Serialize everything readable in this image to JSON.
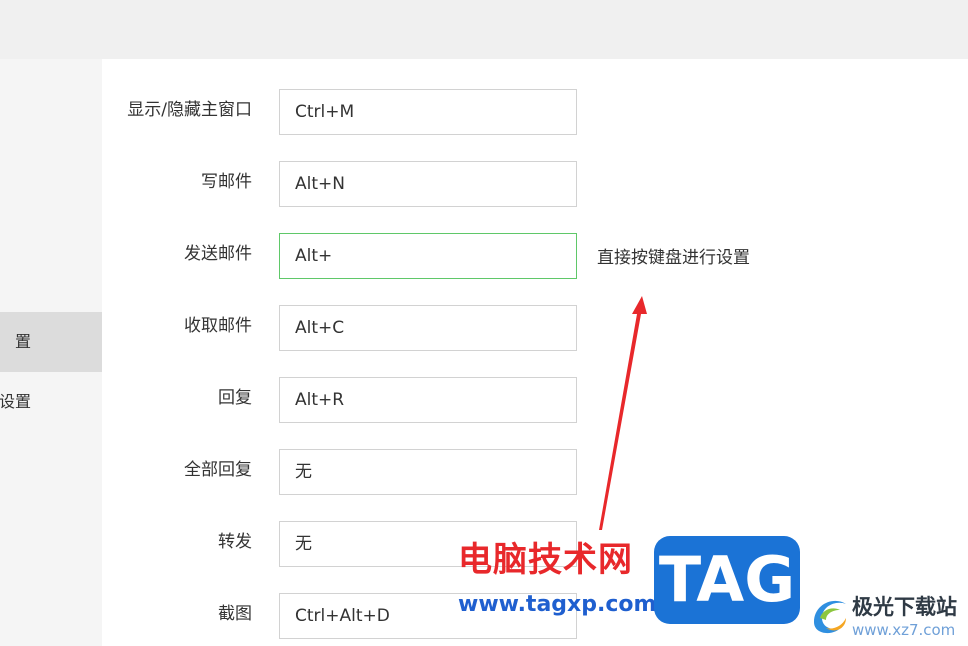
{
  "sidebar": {
    "items": [
      {
        "label": "置",
        "active": true
      },
      {
        "label": "设置",
        "active": false
      }
    ]
  },
  "shortcuts": [
    {
      "label": "显示/隐藏主窗口",
      "value": "Ctrl+M"
    },
    {
      "label": "写邮件",
      "value": "Alt+N"
    },
    {
      "label": "发送邮件",
      "value": "Alt+",
      "focused": true
    },
    {
      "label": "收取邮件",
      "value": "Alt+C"
    },
    {
      "label": "回复",
      "value": "Alt+R"
    },
    {
      "label": "全部回复",
      "value": "无"
    },
    {
      "label": "转发",
      "value": "无"
    },
    {
      "label": "截图",
      "value": "Ctrl+Alt+D"
    }
  ],
  "annotation": {
    "hint": "直接按键盘进行设置",
    "arrow_color": "#e8282b"
  },
  "watermark": {
    "title": "电脑技术网",
    "url": "www.tagxp.com",
    "logo_text": "TAG",
    "site_name": "极光下载站",
    "site_url": "www.xz7.com"
  },
  "colors": {
    "focus_border": "#5fc869",
    "input_border": "#d2d2d2",
    "sidebar_active": "#dcdcdc",
    "watermark_red": "#e8282b",
    "watermark_blue": "#1f5fcf",
    "logo_blue": "#1b73d6"
  }
}
